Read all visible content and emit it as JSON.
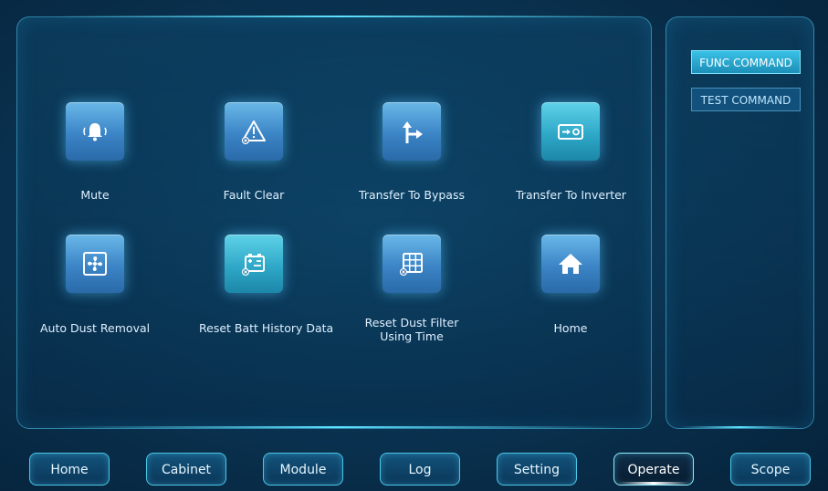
{
  "actions": [
    {
      "label": "Mute",
      "icon": "bell-icon"
    },
    {
      "label": "Fault Clear",
      "icon": "warning-icon"
    },
    {
      "label": "Transfer To Bypass",
      "icon": "bypass-arrow-icon"
    },
    {
      "label": "Transfer To Inverter",
      "icon": "inverter-switch-icon"
    },
    {
      "label": "Auto Dust Removal",
      "icon": "fan-icon"
    },
    {
      "label": "Reset Batt History Data",
      "icon": "battery-reset-icon"
    },
    {
      "label": "Reset Dust Filter Using Time",
      "label_line1": "Reset Dust Filter",
      "label_line2": "Using Time",
      "icon": "filter-grid-icon"
    },
    {
      "label": "Home",
      "icon": "home-icon"
    }
  ],
  "side_commands": [
    {
      "label": "FUNC COMMAND",
      "active": true
    },
    {
      "label": "TEST COMMAND",
      "active": false
    }
  ],
  "nav": [
    {
      "label": "Home"
    },
    {
      "label": "Cabinet"
    },
    {
      "label": "Module"
    },
    {
      "label": "Log"
    },
    {
      "label": "Setting"
    },
    {
      "label": "Operate",
      "active": true
    },
    {
      "label": "Scope"
    }
  ],
  "colors": {
    "background": "#0a3554",
    "accent": "#5fe3ff",
    "tile_blue": "#3b84c6",
    "tile_teal": "#2fa8c8"
  }
}
